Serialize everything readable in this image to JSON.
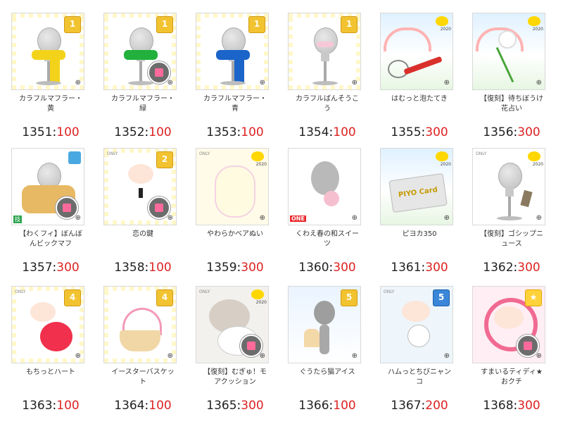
{
  "items": [
    {
      "name_line1": "カラフルマフラー・",
      "name_line2": "黄",
      "id": "1351",
      "price": "100",
      "badge": "1"
    },
    {
      "name_line1": "カラフルマフラー・",
      "name_line2": "緑",
      "id": "1352",
      "price": "100",
      "badge": "1"
    },
    {
      "name_line1": "カラフルマフラー・",
      "name_line2": "青",
      "id": "1353",
      "price": "100",
      "badge": "1"
    },
    {
      "name_line1": "カラフルばんそうこ",
      "name_line2": "う",
      "id": "1354",
      "price": "100",
      "badge": "1"
    },
    {
      "name_line1": "はむっと泡たてき",
      "name_line2": "",
      "id": "1355",
      "price": "300",
      "badge": ""
    },
    {
      "name_line1": "【復刻】待ちぼうけ",
      "name_line2": "花占い",
      "id": "1356",
      "price": "300",
      "badge": ""
    },
    {
      "name_line1": "【わくフィ】ぼんぼ",
      "name_line2": "んビックマフ",
      "id": "1357",
      "price": "300",
      "badge": ""
    },
    {
      "name_line1": "恋の鍵",
      "name_line2": "",
      "id": "1358",
      "price": "100",
      "badge": "2"
    },
    {
      "name_line1": "やわらかベアぬい",
      "name_line2": "",
      "id": "1359",
      "price": "300",
      "badge": ""
    },
    {
      "name_line1": "くわえ春の和スイー",
      "name_line2": "ツ",
      "id": "1360",
      "price": "300",
      "badge": ""
    },
    {
      "name_line1": "ピヨカ350",
      "name_line2": "",
      "id": "1361",
      "price": "300",
      "badge": ""
    },
    {
      "name_line1": "【復刻】ゴシップニ",
      "name_line2": "ュース",
      "id": "1362",
      "price": "300",
      "badge": ""
    },
    {
      "name_line1": "もちっとハート",
      "name_line2": "",
      "id": "1363",
      "price": "100",
      "badge": "4"
    },
    {
      "name_line1": "イースターバスケッ",
      "name_line2": "ト",
      "id": "1364",
      "price": "100",
      "badge": "4"
    },
    {
      "name_line1": "【復刻】むぎゅ！モ",
      "name_line2": "アクッション",
      "id": "1365",
      "price": "300",
      "badge": ""
    },
    {
      "name_line1": "ぐうたら猫アイス",
      "name_line2": "",
      "id": "1366",
      "price": "100",
      "badge": "5"
    },
    {
      "name_line1": "ハムっとちびニャン",
      "name_line2": "コ",
      "id": "1367",
      "price": "200",
      "badge": "5"
    },
    {
      "name_line1": "すまいるティディ★",
      "name_line2": "おクチ",
      "id": "1368",
      "price": "300",
      "badge": ""
    }
  ],
  "labels": {
    "year_tag": "2020",
    "only_tag": "ONLY",
    "card_text": "PIYO Card",
    "one_tag": "ONE",
    "technique_tag": "技"
  },
  "colors": {
    "muffler_yellow": "#f3d21a",
    "muffler_green": "#21b13c",
    "muffler_blue": "#1b64c9",
    "price_red": "#d22222",
    "badge_gold": "#f2c330"
  }
}
